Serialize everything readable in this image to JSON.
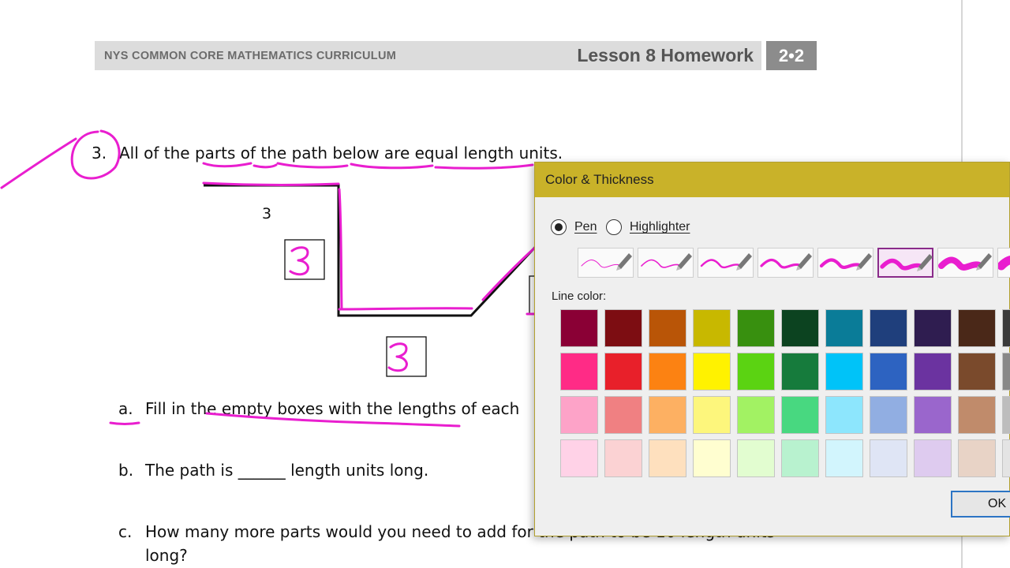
{
  "header": {
    "curriculum": "NYS COMMON CORE MATHEMATICS CURRICULUM",
    "lesson": "Lesson 8 Homework",
    "badge": "2•2"
  },
  "worksheet": {
    "question_number": "3.",
    "question_text": "All of the parts of the path below are equal length units.",
    "path_label": "3",
    "part_a_letter": "a.",
    "part_a_text": "Fill in the empty boxes with the lengths of each",
    "part_b_letter": "b.",
    "part_b_text": "The path is ______ length units long.",
    "part_c_letter": "c.",
    "part_c_text": "How many more parts would you need to add for the path to be 10 length units",
    "part_c_text_2": "long?"
  },
  "handwriting": {
    "box_answers": [
      "3",
      "3"
    ],
    "ink_color": "#e91ecf"
  },
  "dialog": {
    "title": "Color & Thickness",
    "mode_options": [
      "Pen",
      "Highlighter"
    ],
    "selected_mode": "Pen",
    "thickness_selected_index": 5,
    "line_color_label": "Line color:",
    "ok_label": "OK",
    "palette": [
      [
        "#8a0035",
        "#7d0d12",
        "#b95507",
        "#c8b800",
        "#38900f",
        "#0c4320",
        "#0a7c98",
        "#1f3f7c",
        "#2f1d50",
        "#4a2818",
        "#3a3a3a"
      ],
      [
        "#ff2b86",
        "#e8202a",
        "#fc8212",
        "#fff200",
        "#5bd312",
        "#167b3c",
        "#00c3f8",
        "#2d63c1",
        "#6b33a0",
        "#7a4a2c",
        "#888888"
      ],
      [
        "#fda3c8",
        "#f08082",
        "#fdb062",
        "#fdf67c",
        "#a2f263",
        "#48d880",
        "#8de6fd",
        "#91aee2",
        "#9a66cc",
        "#c08b6b",
        "#bdbdbd"
      ],
      [
        "#ffd2e7",
        "#fbd2d3",
        "#fee0be",
        "#fffed0",
        "#e2fdd0",
        "#b8f2cf",
        "#d2f5fd",
        "#dfe5f5",
        "#decbef",
        "#e8d3c6",
        "#e4e4e4"
      ]
    ]
  }
}
